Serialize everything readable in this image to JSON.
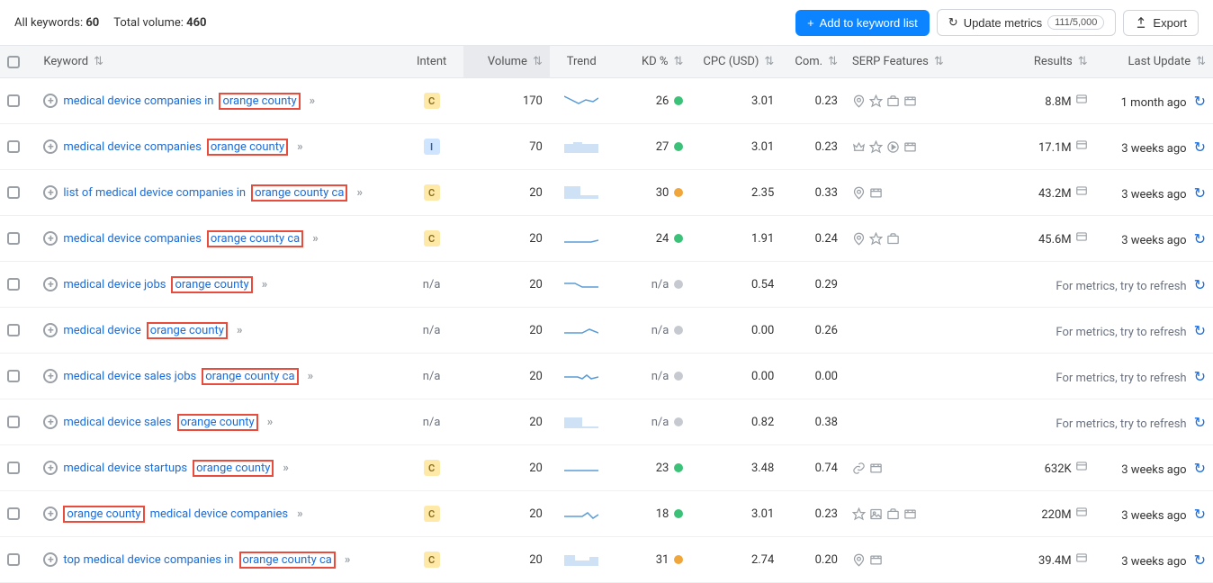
{
  "summary": {
    "all_keywords_label": "All keywords:",
    "all_keywords": "60",
    "total_volume_label": "Total volume:",
    "total_volume": "460"
  },
  "buttons": {
    "add": "Add to keyword list",
    "update": "Update metrics",
    "quota": "111/5,000",
    "export": "Export"
  },
  "columns": {
    "keyword": "Keyword",
    "intent": "Intent",
    "volume": "Volume",
    "trend": "Trend",
    "kd": "KD %",
    "cpc": "CPC (USD)",
    "com": "Com.",
    "serp": "SERP Features",
    "results": "Results",
    "update": "Last Update"
  },
  "refresh_msg": "For metrics, try to refresh",
  "rows": [
    {
      "kw_pre": "medical device companies in",
      "kw_hl": "orange county",
      "kw_post": "",
      "intent": "C",
      "volume": "170",
      "trend": "t1",
      "kd": "26",
      "kd_color": "green",
      "cpc": "3.01",
      "com": "0.23",
      "serp": [
        "pin",
        "star",
        "briefcase",
        "video"
      ],
      "results": "8.8M",
      "update": "1 month ago",
      "refresh": false
    },
    {
      "kw_pre": "medical device companies",
      "kw_hl": "orange county",
      "kw_post": "",
      "intent": "I",
      "volume": "70",
      "trend": "t2",
      "kd": "27",
      "kd_color": "green",
      "cpc": "3.01",
      "com": "0.23",
      "serp": [
        "crown",
        "star",
        "play",
        "video"
      ],
      "results": "17.1M",
      "update": "3 weeks ago",
      "refresh": false
    },
    {
      "kw_pre": "list of medical device companies in",
      "kw_hl": "orange county ca",
      "kw_post": "",
      "intent": "C",
      "volume": "20",
      "trend": "t3",
      "kd": "30",
      "kd_color": "orange",
      "cpc": "2.35",
      "com": "0.33",
      "serp": [
        "pin",
        "video"
      ],
      "results": "43.2M",
      "update": "3 weeks ago",
      "refresh": false
    },
    {
      "kw_pre": "medical device companies",
      "kw_hl": "orange county ca",
      "kw_post": "",
      "intent": "C",
      "volume": "20",
      "trend": "t4",
      "kd": "24",
      "kd_color": "green",
      "cpc": "1.91",
      "com": "0.24",
      "serp": [
        "pin",
        "star",
        "briefcase"
      ],
      "results": "45.6M",
      "update": "3 weeks ago",
      "refresh": false
    },
    {
      "kw_pre": "medical device jobs",
      "kw_hl": "orange county",
      "kw_post": "",
      "intent": "",
      "volume": "20",
      "trend": "t5",
      "kd": "n/a",
      "kd_color": "grey",
      "cpc": "0.54",
      "com": "0.29",
      "serp": [],
      "results": "",
      "update": "",
      "refresh": true
    },
    {
      "kw_pre": "medical device",
      "kw_hl": "orange county",
      "kw_post": "",
      "intent": "",
      "volume": "20",
      "trend": "t6",
      "kd": "n/a",
      "kd_color": "grey",
      "cpc": "0.00",
      "com": "0.26",
      "serp": [],
      "results": "",
      "update": "",
      "refresh": true
    },
    {
      "kw_pre": "medical device sales jobs",
      "kw_hl": "orange county ca",
      "kw_post": "",
      "intent": "",
      "volume": "20",
      "trend": "t7",
      "kd": "n/a",
      "kd_color": "grey",
      "cpc": "0.00",
      "com": "0.00",
      "serp": [],
      "results": "",
      "update": "",
      "refresh": true
    },
    {
      "kw_pre": "medical device sales",
      "kw_hl": "orange county",
      "kw_post": "",
      "intent": "",
      "volume": "20",
      "trend": "t8",
      "kd": "n/a",
      "kd_color": "grey",
      "cpc": "0.82",
      "com": "0.38",
      "serp": [],
      "results": "",
      "update": "",
      "refresh": true
    },
    {
      "kw_pre": "medical device startups",
      "kw_hl": "orange county",
      "kw_post": "",
      "intent": "C",
      "volume": "20",
      "trend": "t9",
      "kd": "23",
      "kd_color": "green",
      "cpc": "3.48",
      "com": "0.74",
      "serp": [
        "link",
        "video"
      ],
      "results": "632K",
      "update": "3 weeks ago",
      "refresh": false
    },
    {
      "kw_pre": "",
      "kw_hl": "orange county",
      "kw_post": "medical device companies",
      "intent": "C",
      "volume": "20",
      "trend": "t10",
      "kd": "18",
      "kd_color": "green",
      "cpc": "3.01",
      "com": "0.23",
      "serp": [
        "star",
        "image",
        "briefcase",
        "video"
      ],
      "results": "220M",
      "update": "3 weeks ago",
      "refresh": false
    },
    {
      "kw_pre": "top medical device companies in",
      "kw_hl": "orange county ca",
      "kw_post": "",
      "intent": "C",
      "volume": "20",
      "trend": "t11",
      "kd": "31",
      "kd_color": "orange",
      "cpc": "2.74",
      "com": "0.20",
      "serp": [
        "pin",
        "video"
      ],
      "results": "39.4M",
      "update": "3 weeks ago",
      "refresh": false
    }
  ]
}
